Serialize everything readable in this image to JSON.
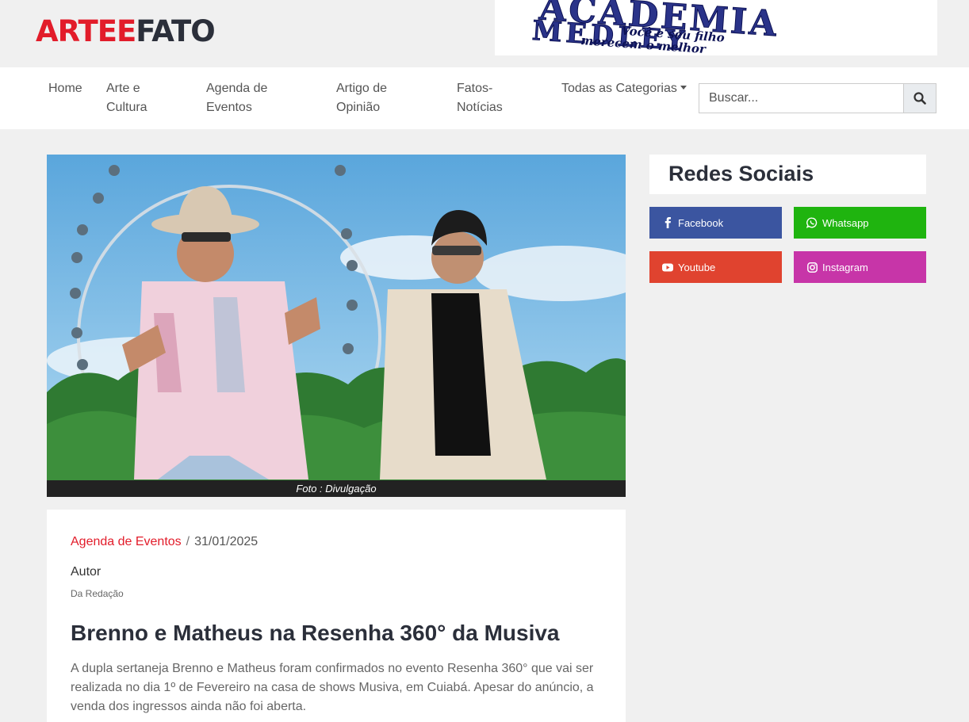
{
  "header": {
    "logo_part1": "ARTEE",
    "logo_part2": "FATO",
    "ad": {
      "line1": "ACADEMIA",
      "line2": "MEDLEY",
      "tagline1": "Você e seu filho",
      "tagline2": "merecem o melhor"
    }
  },
  "nav": {
    "items": [
      {
        "label": "Home"
      },
      {
        "label1": "Arte e",
        "label2": "Cultura"
      },
      {
        "label1": "Agenda de",
        "label2": "Eventos"
      },
      {
        "label1": "Artigo de",
        "label2": "Opinião"
      },
      {
        "label1": "Fatos-",
        "label2": "Notícias"
      },
      {
        "label": "Todas as Categorias"
      }
    ],
    "search_placeholder": "Buscar..."
  },
  "hero": {
    "caption": "Foto : Divulgação"
  },
  "article": {
    "category": "Agenda de Eventos",
    "separator": "/",
    "date": "31/01/2025",
    "author_label": "Autor",
    "author_name": "Da Redação",
    "title": "Brenno e Matheus na Resenha 360° da Musiva",
    "body": "A dupla sertaneja Brenno e Matheus foram confirmados no evento Resenha 360° que vai ser realizada no dia 1º de Fevereiro na casa de shows Musiva, em Cuiabá. Apesar do anúncio, a venda dos ingressos ainda não foi aberta."
  },
  "sidebar": {
    "title": "Redes Sociais",
    "social": [
      {
        "label": "Facebook",
        "icon": "facebook-icon",
        "color": "#3b55a0"
      },
      {
        "label": "Whatsapp",
        "icon": "whatsapp-icon",
        "color": "#1fb40f"
      },
      {
        "label": "Youtube",
        "icon": "youtube-icon",
        "color": "#e0432f"
      },
      {
        "label": "Instagram",
        "icon": "instagram-icon",
        "color": "#c735a8"
      }
    ]
  },
  "colors": {
    "brand_red": "#e21c2a",
    "brand_dark": "#2b2f3a"
  }
}
